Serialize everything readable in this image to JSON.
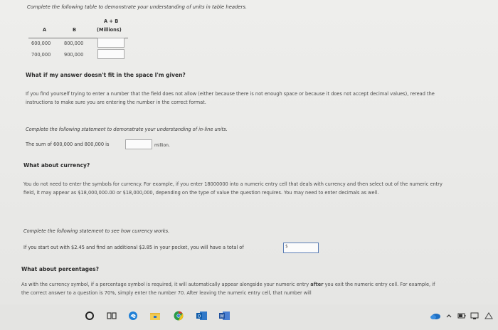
{
  "intro": "Complete the following table to demonstrate your understanding of units in table headers.",
  "table": {
    "headers": {
      "a": "A",
      "b": "B",
      "sum_top": "A + B",
      "sum_bottom": "(Millions)"
    },
    "rows": [
      {
        "a": "600,000",
        "b": "800,000"
      },
      {
        "a": "700,000",
        "b": "900,000"
      }
    ]
  },
  "sections": {
    "fit": {
      "heading": "What if my answer doesn't fit in the space I'm given?",
      "body": "If you find yourself trying to enter a number that the field does not allow (either because there is not enough space or because it does not accept decimal values), reread the instructions to make sure you are entering the number in the correct format."
    },
    "inline": {
      "prompt": "Complete the following statement to demonstrate your understanding of in-line units.",
      "sentence_start": "The sum of 600,000 and 800,000 is",
      "unit": "million."
    },
    "currency": {
      "heading": "What about currency?",
      "body": "You do not need to enter the symbols for currency. For example, if you enter 18000000 into a numeric entry cell that deals with currency and then select out of the numeric entry field, it may appear as $18,000,000.00 or $18,000,000, depending on the type of value the question requires. You may need to enter decimals as well.",
      "prompt": "Complete the following statement to see how currency works.",
      "sentence_start": "If you start out with $2.45 and find an additional $3.85 in your pocket, you will have a total of",
      "prefix": "$"
    },
    "percent": {
      "heading": "What about percentages?",
      "body_pre": "As with the currency symbol, if a percentage symbol is required, it will automatically appear alongside your numeric entry",
      "body_bold": "after",
      "body_post": "you exit the numeric entry cell. For example, if the correct answer to a question is 70%, simply enter the number 70. After leaving the numeric entry cell, that number will"
    }
  },
  "taskbar": {
    "icons": [
      "search-circle-icon",
      "task-view-icon",
      "edge-icon",
      "file-explorer-icon",
      "chrome-icon",
      "outlook-icon",
      "word-icon"
    ],
    "tray": [
      "onedrive-icon",
      "chevron-up-icon",
      "battery-icon",
      "network-icon",
      "notification-icon"
    ]
  }
}
